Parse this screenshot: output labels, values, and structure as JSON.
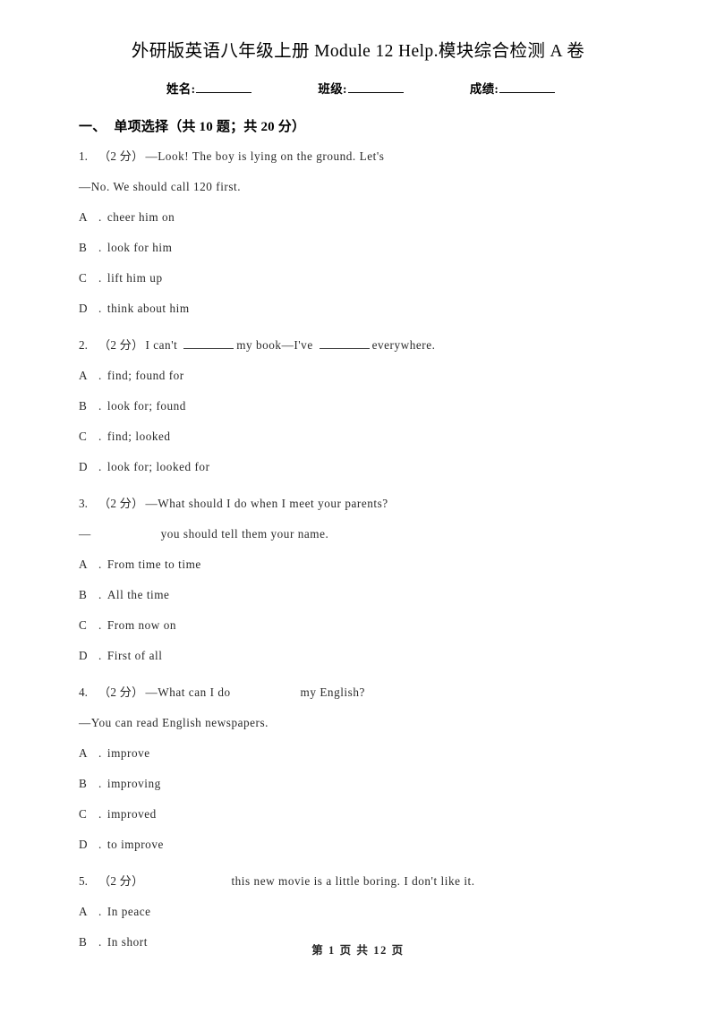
{
  "document": {
    "title": "外研版英语八年级上册 Module 12 Help.模块综合检测 A 卷"
  },
  "identity_fields": [
    {
      "label": "姓名:"
    },
    {
      "label": "班级:"
    },
    {
      "label": "成绩:"
    }
  ],
  "section": {
    "number": "一、",
    "title": "单项选择（共 10 题；共 20 分）"
  },
  "questions": [
    {
      "number": "1.",
      "marks": "（2 分）",
      "lines": [
        {
          "segments": [
            {
              "type": "text",
              "value": "—Look! The boy is lying on the ground. Let's"
            }
          ]
        },
        {
          "segments": [
            {
              "type": "text",
              "value": "—No. We should call 120 first."
            }
          ]
        }
      ],
      "options": [
        {
          "letter": "A",
          "text": "cheer him on"
        },
        {
          "letter": "B",
          "text": "look for him"
        },
        {
          "letter": "C",
          "text": "lift him up"
        },
        {
          "letter": "D",
          "text": "think about him"
        }
      ]
    },
    {
      "number": "2.",
      "marks": "（2 分）",
      "lines": [
        {
          "segments": [
            {
              "type": "text",
              "value": "I can't"
            },
            {
              "type": "underline"
            },
            {
              "type": "text",
              "value": "my book—I've"
            },
            {
              "type": "underline"
            },
            {
              "type": "text",
              "value": "everywhere."
            }
          ]
        }
      ],
      "options": [
        {
          "letter": "A",
          "text": "find; found for"
        },
        {
          "letter": "B",
          "text": "look for; found"
        },
        {
          "letter": "C",
          "text": "find; looked"
        },
        {
          "letter": "D",
          "text": "look for; looked for"
        }
      ]
    },
    {
      "number": "3.",
      "marks": "（2 分）",
      "lines": [
        {
          "segments": [
            {
              "type": "text",
              "value": "—What should I do when I meet your parents?"
            }
          ]
        },
        {
          "segments": [
            {
              "type": "text",
              "value": "—"
            },
            {
              "type": "gap"
            },
            {
              "type": "text",
              "value": "you should tell them your name."
            }
          ]
        }
      ],
      "options": [
        {
          "letter": "A",
          "text": "From time to time"
        },
        {
          "letter": "B",
          "text": "All the time"
        },
        {
          "letter": "C",
          "text": "From now on"
        },
        {
          "letter": "D",
          "text": "First of all"
        }
      ]
    },
    {
      "number": "4.",
      "marks": "（2 分）",
      "lines": [
        {
          "segments": [
            {
              "type": "text",
              "value": "—What can I do"
            },
            {
              "type": "gap"
            },
            {
              "type": "text",
              "value": "my English?"
            }
          ]
        },
        {
          "segments": [
            {
              "type": "text",
              "value": "—You can read English newspapers."
            }
          ]
        }
      ],
      "options": [
        {
          "letter": "A",
          "text": "improve"
        },
        {
          "letter": "B",
          "text": "improving"
        },
        {
          "letter": "C",
          "text": "improved"
        },
        {
          "letter": "D",
          "text": "to improve"
        }
      ]
    },
    {
      "number": "5.",
      "marks": "（2 分）",
      "lines": [
        {
          "segments": [
            {
              "type": "gap-wide"
            },
            {
              "type": "text",
              "value": "this new movie is a little boring. I don't like it."
            }
          ]
        }
      ],
      "options": [
        {
          "letter": "A",
          "text": "In peace"
        },
        {
          "letter": "B",
          "text": "In short"
        }
      ]
    }
  ],
  "footer": {
    "text": "第 1 页 共 12 页"
  }
}
